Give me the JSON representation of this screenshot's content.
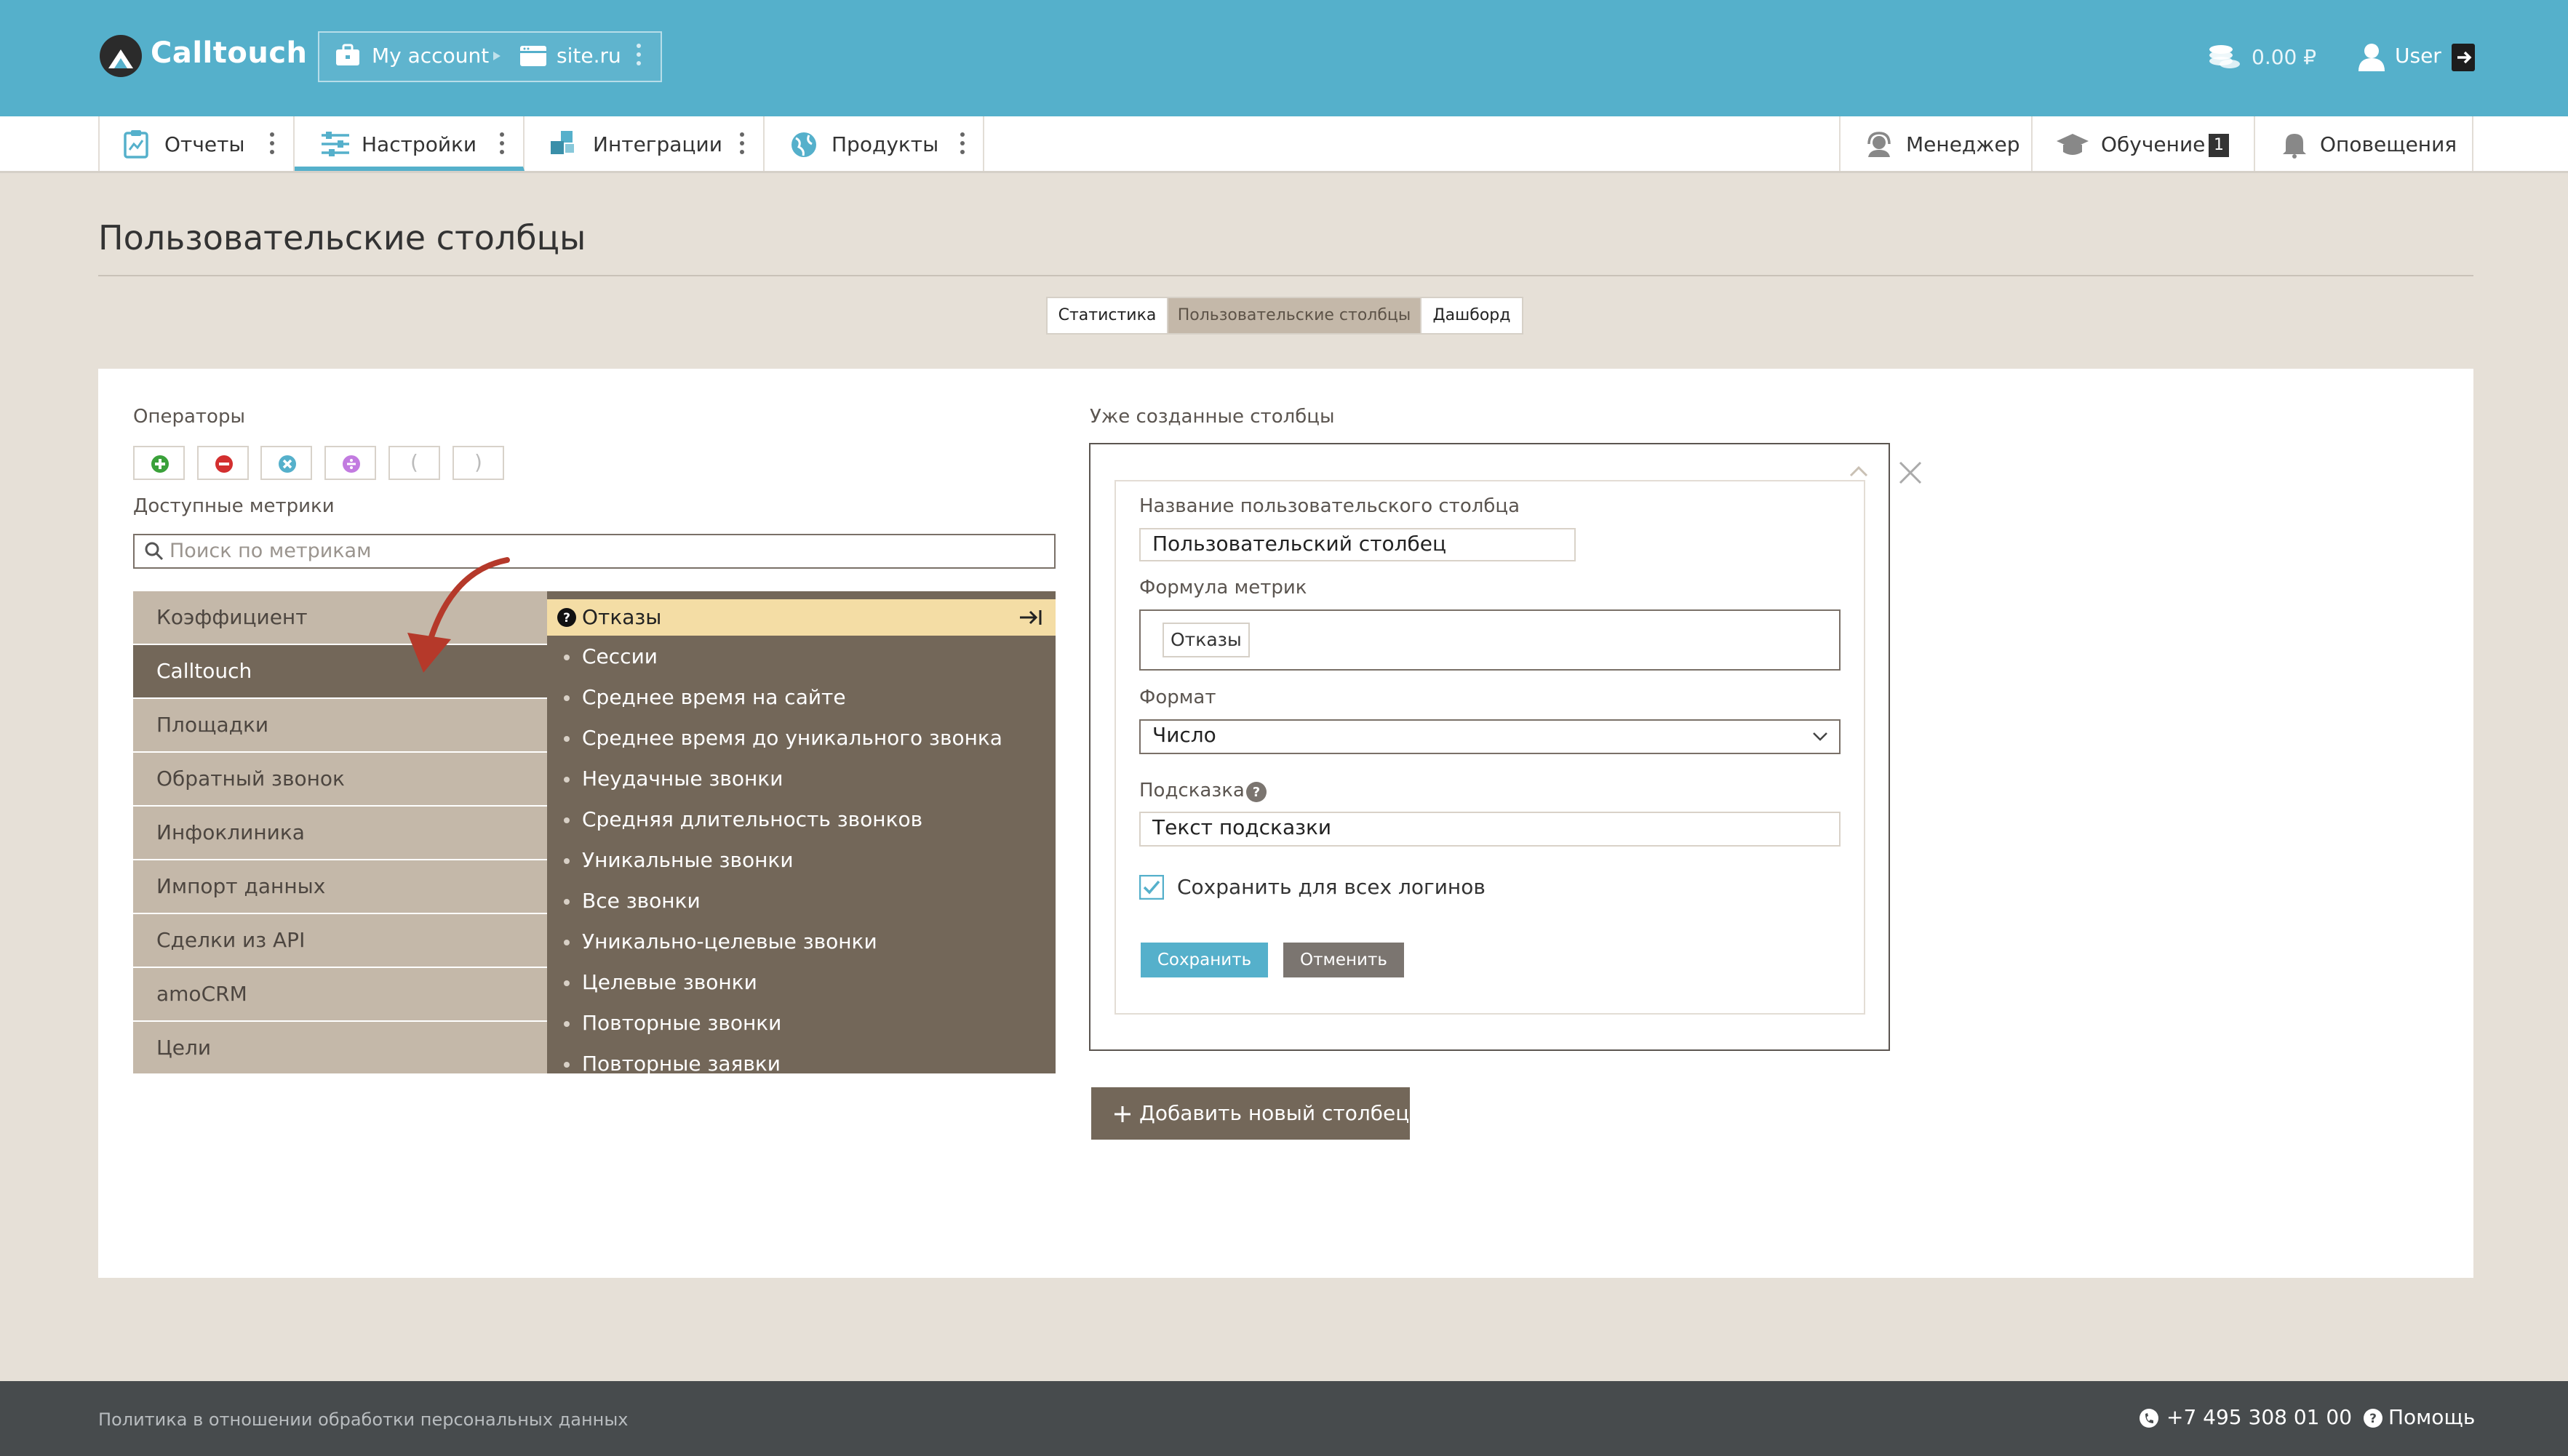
{
  "header": {
    "brand": "Calltouch",
    "account_label": "My account",
    "site_label": "site.ru",
    "balance": "0.00 ₽",
    "user_label": "User"
  },
  "nav": {
    "left": [
      {
        "label": "Отчеты"
      },
      {
        "label": "Настройки"
      },
      {
        "label": "Интеграции"
      },
      {
        "label": "Продукты"
      }
    ],
    "right": {
      "manager": "Менеджер",
      "training": "Обучение",
      "training_badge": "1",
      "notifications": "Оповещения"
    }
  },
  "page": {
    "title": "Пользовательские столбцы",
    "subtabs": [
      "Статистика",
      "Пользовательские столбцы",
      "Дашборд"
    ],
    "selected_subtab": 1
  },
  "left_panel": {
    "operators_label": "Операторы",
    "operators": [
      "plus",
      "minus",
      "multiply",
      "divide",
      "(",
      ")"
    ],
    "metrics_label": "Доступные метрики",
    "search_placeholder": "Поиск по метрикам",
    "categories": [
      "Коэффициент",
      "Calltouch",
      "Площадки",
      "Обратный звонок",
      "Инфоклиника",
      "Импорт данных",
      "Сделки из API",
      "amoCRM",
      "Цели"
    ],
    "selected_category": 1,
    "highlighted_metric": "Отказы",
    "metrics": [
      "Сессии",
      "Среднее время на сайте",
      "Среднее время до уникального звонка",
      "Неудачные звонки",
      "Средняя длительность звонков",
      "Уникальные звонки",
      "Все звонки",
      "Уникально-целевые звонки",
      "Целевые звонки",
      "Повторные звонки",
      "Повторные заявки"
    ]
  },
  "right_panel": {
    "section_label": "Уже созданные столбцы",
    "form": {
      "name_label": "Название пользовательского столбца",
      "name_value": "Пользовательский столбец",
      "formula_label": "Формула метрик",
      "formula_token": "Отказы",
      "format_label": "Формат",
      "format_value": "Число",
      "hint_label": "Подсказка",
      "hint_value": "Текст подсказки",
      "save_all_label": "Сохранить для всех логинов",
      "save_all_checked": true,
      "save_button": "Сохранить",
      "cancel_button": "Отменить"
    },
    "add_button": "Добавить новый столбец"
  },
  "footer": {
    "policy": "Политика в отношении обработки персональных данных",
    "phone": "+7 495 308 01 00",
    "help": "Помощь"
  },
  "colors": {
    "header": "#55b0cb",
    "accent_brown": "#736759",
    "category_bg": "#c4b8a9",
    "highlight": "#f4dda5",
    "page_bg": "#e6e0d7",
    "footer": "#474b4d",
    "annotation_arrow": "#b5392a"
  }
}
